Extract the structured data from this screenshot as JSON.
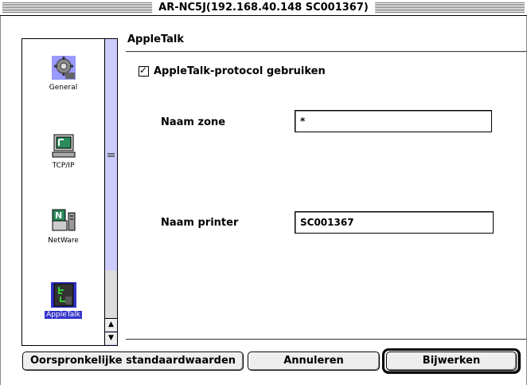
{
  "window": {
    "title": "AR-NC5J(192.168.40.148 SC001367)"
  },
  "sidebar": {
    "items": [
      {
        "label": "General",
        "icon": "gear-icon"
      },
      {
        "label": "TCP/IP",
        "icon": "computer-icon"
      },
      {
        "label": "NetWare",
        "icon": "network-icon"
      },
      {
        "label": "AppleTalk",
        "icon": "appletalk-icon"
      }
    ],
    "selected": "AppleTalk"
  },
  "panel": {
    "title": "AppleTalk",
    "checkbox_label": "AppleTalk-protocol gebruiken",
    "checkbox_checked": true,
    "zone_label": "Naam zone",
    "zone_value": "*",
    "printer_label": "Naam printer",
    "printer_value": "SC001367"
  },
  "buttons": {
    "defaults_label": "Oorspronkelijke standaardwaarden",
    "cancel_label": "Annuleren",
    "update_label": "Bijwerken"
  },
  "colors": {
    "selection": "#3333cc",
    "scroll_track": "#ccccff"
  }
}
